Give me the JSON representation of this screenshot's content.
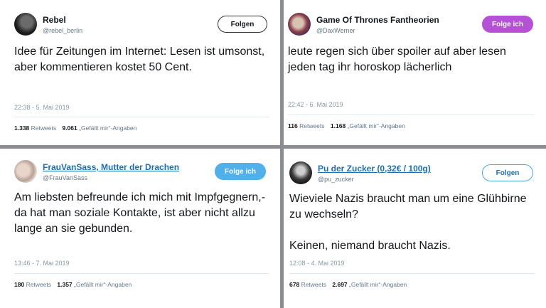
{
  "tweets": [
    {
      "display_name": "Rebel",
      "handle": "@rebel_berlin",
      "button": "Folgen",
      "text": [
        "Idee für Zeitungen im Internet: Lesen ist umsonst, aber kommentieren kostet 50 Cent."
      ],
      "time": "22:38 - 5. Mai 2019",
      "retweets": "1.338",
      "retweets_label": "Retweets",
      "likes": "9.061",
      "likes_label": "„Gefällt mir“-Angaben"
    },
    {
      "display_name": "Game Of Thrones Fantheorien",
      "handle": "@DaxWerner",
      "button": "Folge ich",
      "text": [
        "leute regen sich über spoiler auf aber lesen jeden tag  ihr horoskop lächerlich"
      ],
      "time": "22:42 - 6. Mai 2019",
      "retweets": "116",
      "retweets_label": "Retweets",
      "likes": "1.168",
      "likes_label": "„Gefällt mir“-Angaben"
    },
    {
      "display_name": "FrauVanSass, Mutter der Drachen",
      "handle": "@FrauVanSass",
      "button": "Folge ich",
      "text": [
        "Am liebsten befreunde ich mich mit Impfgegnern,- da hat man soziale Kontakte, ist aber nicht allzu lange an sie gebunden."
      ],
      "time": "13:46 - 7. Mai 2019",
      "retweets": "180",
      "retweets_label": "Retweets",
      "likes": "1.357",
      "likes_label": "„Gefällt mir“-Angaben"
    },
    {
      "display_name": "Pu der Zucker (0,32€ / 100g)",
      "handle": "@pu_zucker",
      "button": "Folgen",
      "text": [
        "Wieviele Nazis braucht man um eine Glühbirne zu wechseln?",
        "Keinen, niemand braucht Nazis."
      ],
      "time": "12:08 - 4. Mai 2019",
      "retweets": "678",
      "retweets_label": "Retweets",
      "likes": "2.697",
      "likes_label": "„Gefällt mir“-Angaben"
    }
  ],
  "colors": {
    "purple_button": "#b551d6",
    "blue_button": "#4fb0ea",
    "link_blue": "#1b6fb8",
    "divider": "#8a8d91"
  },
  "icons": [
    "avatar-rebel",
    "avatar-got",
    "avatar-frauvansass",
    "avatar-pu-der-zucker"
  ]
}
